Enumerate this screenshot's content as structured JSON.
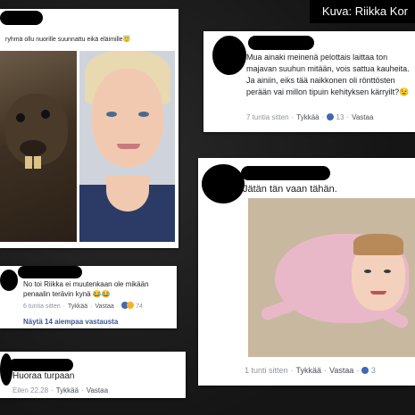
{
  "credit": "Kuva: Riikka Kor",
  "post1": {
    "text": "ryhmä ollu nuorille suunnattu eikä eläimille😇"
  },
  "comment_top_right": {
    "text": "Mua ainaki meinenä pelottais laittaa ton majavan suuhun mitään, vois sattua kauheita. Ja ainiin, eiks tää naikkonen oli rönttösten perään vai millon tipuin kehityksen kärryilt?😉",
    "time": "7 tuntia sitten",
    "like": "Tykkää",
    "reply": "Vastaa",
    "likes": "13",
    "reply_tail": "Vastaa"
  },
  "comment_middle_left": {
    "text": "No toi Riikka ei muutenkaan ole mikään penaalin terävin kynä 😂😂",
    "time": "6 tuntia sitten",
    "like": "Tykkää",
    "reply": "Vastaa",
    "reactions": "74",
    "more_replies": "Näytä 14 aiempaa vastausta"
  },
  "comment_bottom_left": {
    "text": "Huoraa turpaan",
    "time": "Eilen 22.28",
    "like": "Tykkää",
    "reply": "Vastaa"
  },
  "comment_right_large": {
    "text": "Jätän tän vaan tähän.",
    "time": "1 tunti sitten",
    "like": "Tykkää",
    "reply": "Vastaa",
    "count": "3"
  },
  "colors": {
    "background": "#1b1b1b",
    "card": "#ffffff",
    "meta_text": "#90949c",
    "link_blue": "#4267b2",
    "redaction": "#000000"
  },
  "icons": [
    "like-icon",
    "haha-icon",
    "redaction-blob"
  ]
}
